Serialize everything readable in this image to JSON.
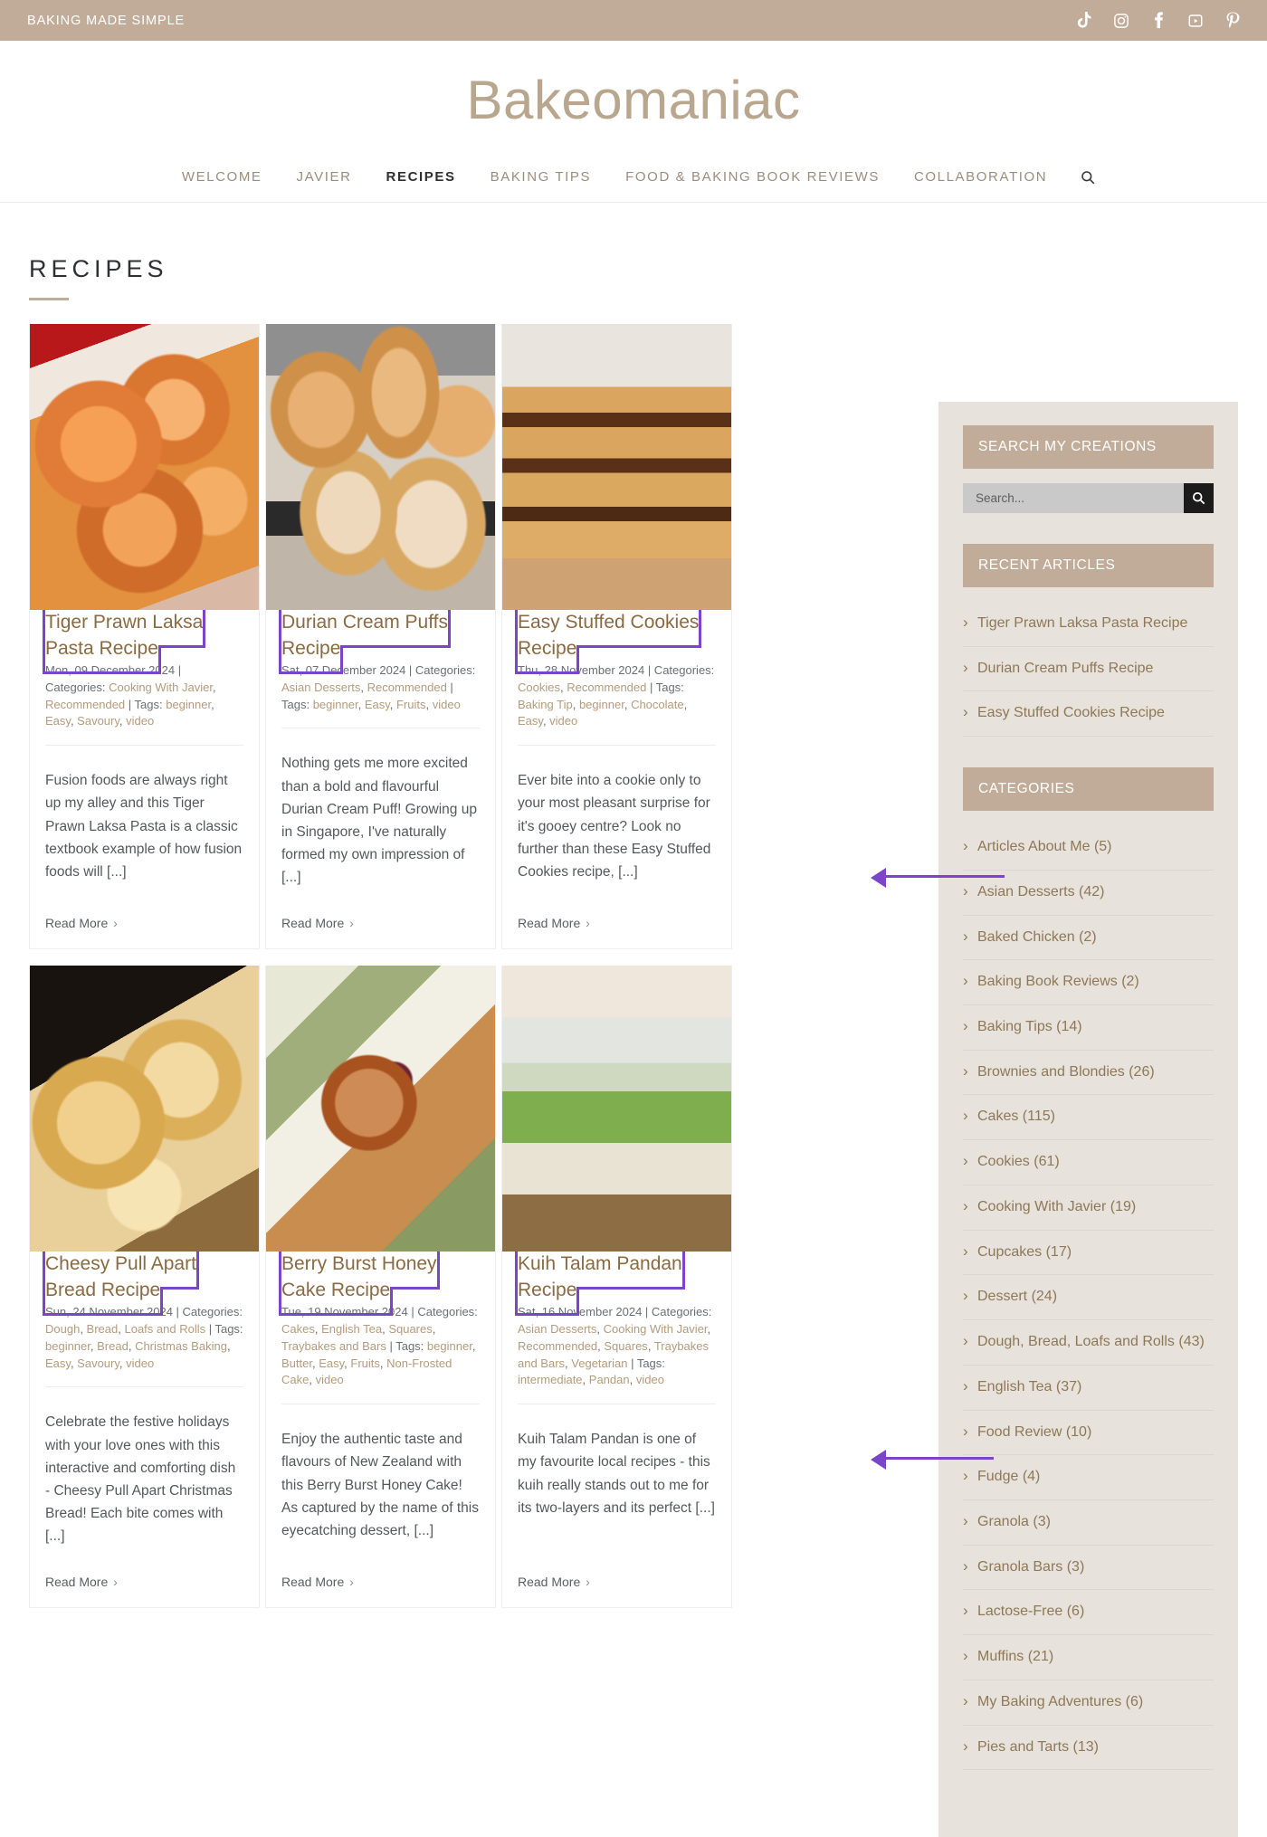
{
  "topbar": {
    "tagline": "BAKING MADE SIMPLE",
    "social": [
      {
        "name": "tiktok-icon",
        "label": "TikTok"
      },
      {
        "name": "instagram-icon",
        "label": "Instagram"
      },
      {
        "name": "facebook-icon",
        "label": "Facebook"
      },
      {
        "name": "youtube-icon",
        "label": "YouTube"
      },
      {
        "name": "pinterest-icon",
        "label": "Pinterest"
      }
    ]
  },
  "brand": {
    "title": "Bakeomaniac"
  },
  "nav": {
    "items": [
      {
        "label": "WELCOME",
        "active": false
      },
      {
        "label": "JAVIER",
        "active": false
      },
      {
        "label": "RECIPES",
        "active": true
      },
      {
        "label": "BAKING TIPS",
        "active": false
      },
      {
        "label": "FOOD & BAKING BOOK REVIEWS",
        "active": false
      },
      {
        "label": "COLLABORATION",
        "active": false
      }
    ],
    "search_icon": "search-icon"
  },
  "main": {
    "page_title": "RECIPES",
    "cards": [
      {
        "title": "Tiger Prawn Laksa Pasta Recipe",
        "date": "Mon, 09 December 2024",
        "categories": "Cooking With Javier, Recommended",
        "tags": "beginner, Easy, Savoury, video",
        "excerpt": "Fusion foods are always right up my alley and this Tiger Prawn Laksa Pasta is a classic textbook example of how fusion foods will [...]",
        "read_more": "Read More",
        "highlighted": true
      },
      {
        "title": "Durian Cream Puffs Recipe",
        "date": "Sat, 07 December 2024",
        "categories": "Asian Desserts, Recommended",
        "tags": "beginner, Easy, Fruits, video",
        "excerpt": "Nothing gets me more excited than a bold and flavourful Durian Cream Puff! Growing up in Singapore, I've naturally formed my own impression of [...]",
        "read_more": "Read More",
        "highlighted": true
      },
      {
        "title": "Easy Stuffed Cookies Recipe",
        "date": "Thu, 28 November 2024",
        "categories": "Cookies, Recommended",
        "tags": "Baking Tip, beginner, Chocolate, Easy, video",
        "excerpt": "Ever bite into a cookie only to your most pleasant surprise for it's gooey centre? Look no further than these Easy Stuffed Cookies recipe, [...]",
        "read_more": "Read More",
        "highlighted": true
      },
      {
        "title": "Cheesy Pull Apart Bread Recipe",
        "date": "Sun, 24 November 2024",
        "categories": "Dough, Bread, Loafs and Rolls",
        "tags": "beginner, Bread, Christmas Baking, Easy, Savoury, video",
        "excerpt": "Celebrate the festive holidays with your love ones with this interactive and comforting dish - Cheesy Pull Apart Christmas Bread! Each bite comes with [...]",
        "read_more": "Read More",
        "highlighted": true
      },
      {
        "title": "Berry Burst Honey Cake Recipe",
        "date": "Tue, 19 November 2024",
        "categories": "Cakes, English Tea, Squares, Traybakes and Bars",
        "tags": "beginner, Butter, Easy, Fruits, Non-Frosted Cake, video",
        "excerpt": "Enjoy the authentic taste and flavours of New Zealand with this Berry Burst Honey Cake! As captured by the name of this eyecatching dessert, [...]",
        "read_more": "Read More",
        "highlighted": true
      },
      {
        "title": "Kuih Talam Pandan Recipe",
        "date": "Sat, 16 November 2024",
        "categories": "Asian Desserts, Cooking With Javier, Recommended, Squares, Traybakes and Bars, Vegetarian",
        "tags": "intermediate, Pandan, video",
        "excerpt": "Kuih Talam Pandan is one of my favourite local recipes - this kuih really stands out to me for its two-layers and its perfect [...]",
        "read_more": "Read More",
        "highlighted": true
      }
    ],
    "meta_labels": {
      "categories": "Categories:",
      "tags": "Tags:",
      "separator": "|"
    }
  },
  "sidebar": {
    "search_widget": {
      "heading": "SEARCH MY CREATIONS",
      "placeholder": "Search...",
      "button_icon": "search-icon"
    },
    "recent_widget": {
      "heading": "RECENT ARTICLES",
      "items": [
        "Tiger Prawn Laksa Pasta Recipe",
        "Durian Cream Puffs Recipe",
        "Easy Stuffed Cookies Recipe"
      ]
    },
    "categories_widget": {
      "heading": "CATEGORIES",
      "items": [
        "Articles About Me (5)",
        "Asian Desserts (42)",
        "Baked Chicken (2)",
        "Baking Book Reviews (2)",
        "Baking Tips (14)",
        "Brownies and Blondies (26)",
        "Cakes (115)",
        "Cookies (61)",
        "Cooking With Javier (19)",
        "Cupcakes (17)",
        "Dessert (24)",
        "Dough, Bread, Loafs and Rolls (43)",
        "English Tea (37)",
        "Food Review (10)",
        "Fudge (4)",
        "Granola (3)",
        "Granola Bars (3)",
        "Lactose-Free (6)",
        "Muffins (21)",
        "My Baking Adventures (6)",
        "Pies and Tarts (13)"
      ]
    }
  },
  "colors": {
    "brand_tan": "#c0ac99",
    "brand_title": "#b9a68f",
    "sidebar_bg": "#e7e2db",
    "card_title": "#8a6a42",
    "link_tan": "#b49b7d",
    "annotation_purple": "#7b44c9",
    "search_field": "#c9c9c9",
    "search_button": "#1b1b1b"
  }
}
